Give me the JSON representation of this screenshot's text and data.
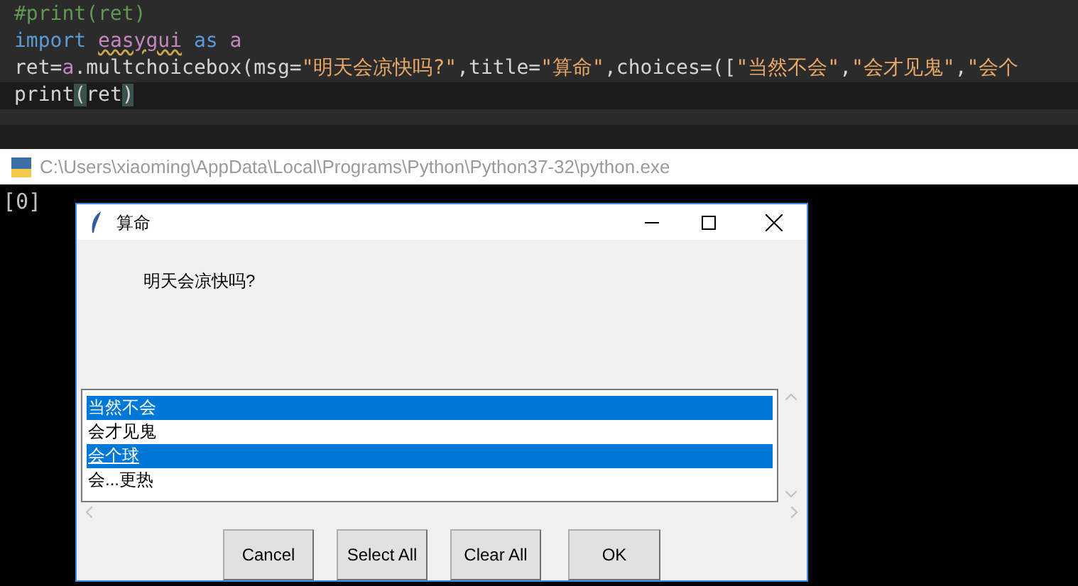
{
  "editor": {
    "lines": [
      {
        "current": false,
        "tokens": [
          {
            "kind": "comment",
            "text": "#print(ret)"
          }
        ]
      },
      {
        "current": false,
        "tokens": [
          {
            "kind": "keyword",
            "text": "import "
          },
          {
            "kind": "module",
            "text": "easygui"
          },
          {
            "kind": "keyword",
            "text": " as "
          },
          {
            "kind": "alias",
            "text": "a"
          }
        ]
      },
      {
        "current": false,
        "tokens": [
          {
            "kind": "plain",
            "text": "ret="
          },
          {
            "kind": "alias",
            "text": "a"
          },
          {
            "kind": "plain",
            "text": ".multchoicebox(msg="
          },
          {
            "kind": "string",
            "text": "\"明天会凉快吗?\""
          },
          {
            "kind": "plain",
            "text": ",title="
          },
          {
            "kind": "string",
            "text": "\"算命\""
          },
          {
            "kind": "plain",
            "text": ",choices=(["
          },
          {
            "kind": "string",
            "text": "\"当然不会\""
          },
          {
            "kind": "plain",
            "text": ","
          },
          {
            "kind": "string",
            "text": "\"会才见鬼\""
          },
          {
            "kind": "plain",
            "text": ","
          },
          {
            "kind": "string",
            "text": "\"会个"
          }
        ]
      },
      {
        "current": true,
        "tokens": [
          {
            "kind": "plain",
            "text": "print"
          },
          {
            "kind": "match",
            "text": "("
          },
          {
            "kind": "plain",
            "text": "ret"
          },
          {
            "kind": "match",
            "text": ")"
          }
        ]
      }
    ]
  },
  "console": {
    "title": "C:\\Users\\xiaoming\\AppData\\Local\\Programs\\Python\\Python37-32\\python.exe",
    "output": "[0]"
  },
  "dialog": {
    "title": "算命",
    "message": "明天会凉快吗?",
    "choices": [
      {
        "label": "当然不会",
        "selected": true,
        "focused": false
      },
      {
        "label": "会才见鬼",
        "selected": false,
        "focused": false
      },
      {
        "label": "会个球",
        "selected": true,
        "focused": true
      },
      {
        "label": "会...更热",
        "selected": false,
        "focused": false
      }
    ],
    "buttons": [
      "Cancel",
      "Select All",
      "Clear All",
      "OK"
    ]
  }
}
